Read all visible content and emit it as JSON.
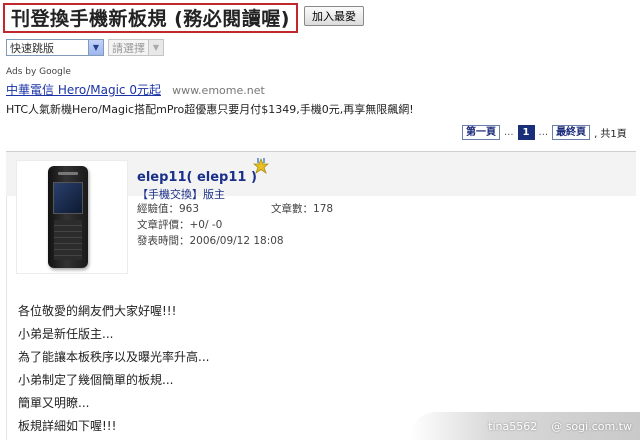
{
  "header": {
    "title": "刊登換手機新板規 (務必閱讀喔)",
    "favorite_label": "加入最愛"
  },
  "nav": {
    "quick_jump": "快速跳版",
    "select_placeholder": "請選擇"
  },
  "ads": {
    "ads_by": "Ads by Google",
    "title": "中華電信 Hero/Magic 0元起",
    "url": "www.emome.net",
    "description": "HTC人氣新機Hero/Magic搭配mPro超優惠只要月付$1349,手機0元,再享無限飆網!"
  },
  "pager": {
    "first": "第一頁",
    "dots_left": "...",
    "current": "1",
    "dots_right": "...",
    "last": "最終頁",
    "total": ", 共1頁"
  },
  "post": {
    "user_name": "elep11( elep11 )",
    "role": "【手機交換】版主",
    "exp_label": "經驗值：",
    "exp_value": "963",
    "articles_label": "文章數：",
    "articles_value": "178",
    "rating_label": "文章評價：",
    "rating_value": "+0/ -0",
    "time_label": "發表時間：",
    "time_value": "2006/09/12 18:08",
    "icons": {
      "avatar": "phone-avatar",
      "badge": "moderator-star-icon"
    },
    "lines": [
      "各位敬愛的網友們大家好喔!!!",
      "小弟是新任版主...",
      "為了能讓本板秩序以及曝光率升高...",
      "小弟制定了幾個簡單的板規...",
      "簡單又明瞭...",
      "板規詳細如下喔!!!"
    ]
  },
  "watermark": {
    "user": "tina5562",
    "site": "@ sogi.com.tw"
  },
  "colors": {
    "title_border": "#c0282d",
    "link_blue": "#1a2f8a",
    "pager_current": "#1a2f7a"
  }
}
